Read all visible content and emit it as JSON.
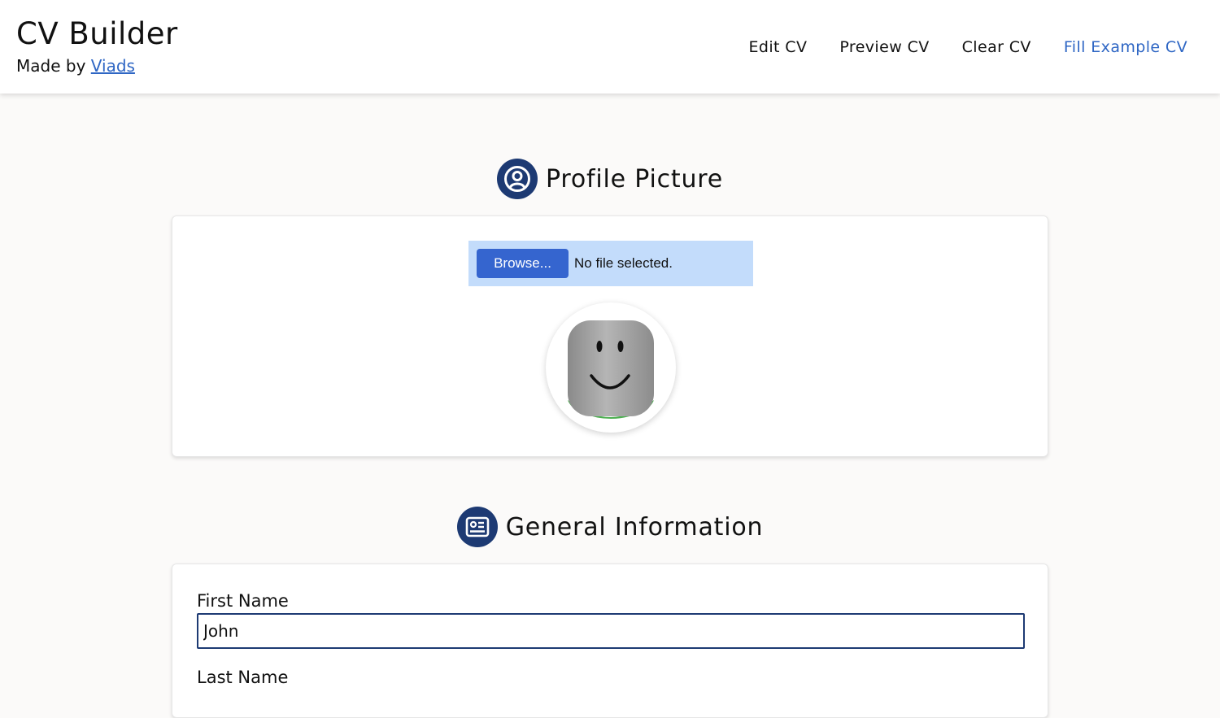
{
  "header": {
    "title": "CV Builder",
    "made_by_prefix": "Made by",
    "author_link": "Viads",
    "nav": [
      {
        "label": "Edit CV"
      },
      {
        "label": "Preview CV"
      },
      {
        "label": "Clear CV"
      },
      {
        "label": "Fill Example CV"
      }
    ]
  },
  "profile_section": {
    "heading": "Profile Picture",
    "icon": "user-circle-icon",
    "browse_label": "Browse...",
    "file_status": "No file selected."
  },
  "general_section": {
    "heading": "General Information",
    "icon": "id-card-icon",
    "first_name_label": "First Name",
    "first_name_value": "John",
    "last_name_label": "Last Name"
  },
  "colors": {
    "accent": "#2e66c4",
    "heading_icon_bg": "#1d3a73",
    "file_box_bg": "#c3dcfb",
    "browse_btn": "#3565cf"
  }
}
